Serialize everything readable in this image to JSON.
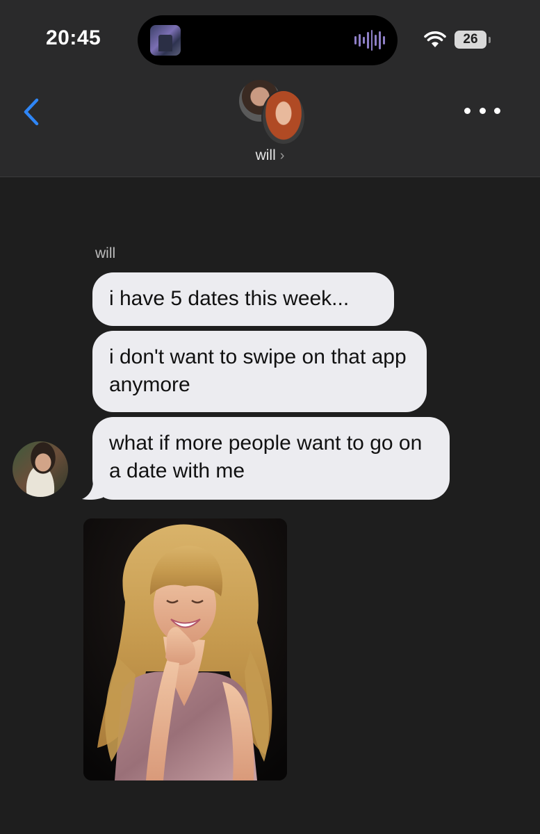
{
  "status_bar": {
    "time": "20:45",
    "battery": "26",
    "icons": [
      "now-playing-artwork",
      "audio-waveform-icon",
      "wifi-icon",
      "battery-icon"
    ]
  },
  "header": {
    "back_icon": "chevron-left-icon",
    "more_icon": "ellipsis-icon",
    "contact_name": "will",
    "contact_chevron": "›"
  },
  "conversation": {
    "sender_name": "will",
    "messages": [
      {
        "text": "i have 5 dates this week..."
      },
      {
        "text": "i don't want to swipe on that app anymore"
      },
      {
        "text": "what if more people want to go on a date with me"
      }
    ],
    "photo_message": {
      "type": "image",
      "subject": "photo"
    }
  },
  "colors": {
    "background": "#1e1e1e",
    "header_background": "#2a2a2b",
    "incoming_bubble": "#ececf0",
    "incoming_text": "#111111",
    "accent": "#2f86f6"
  }
}
